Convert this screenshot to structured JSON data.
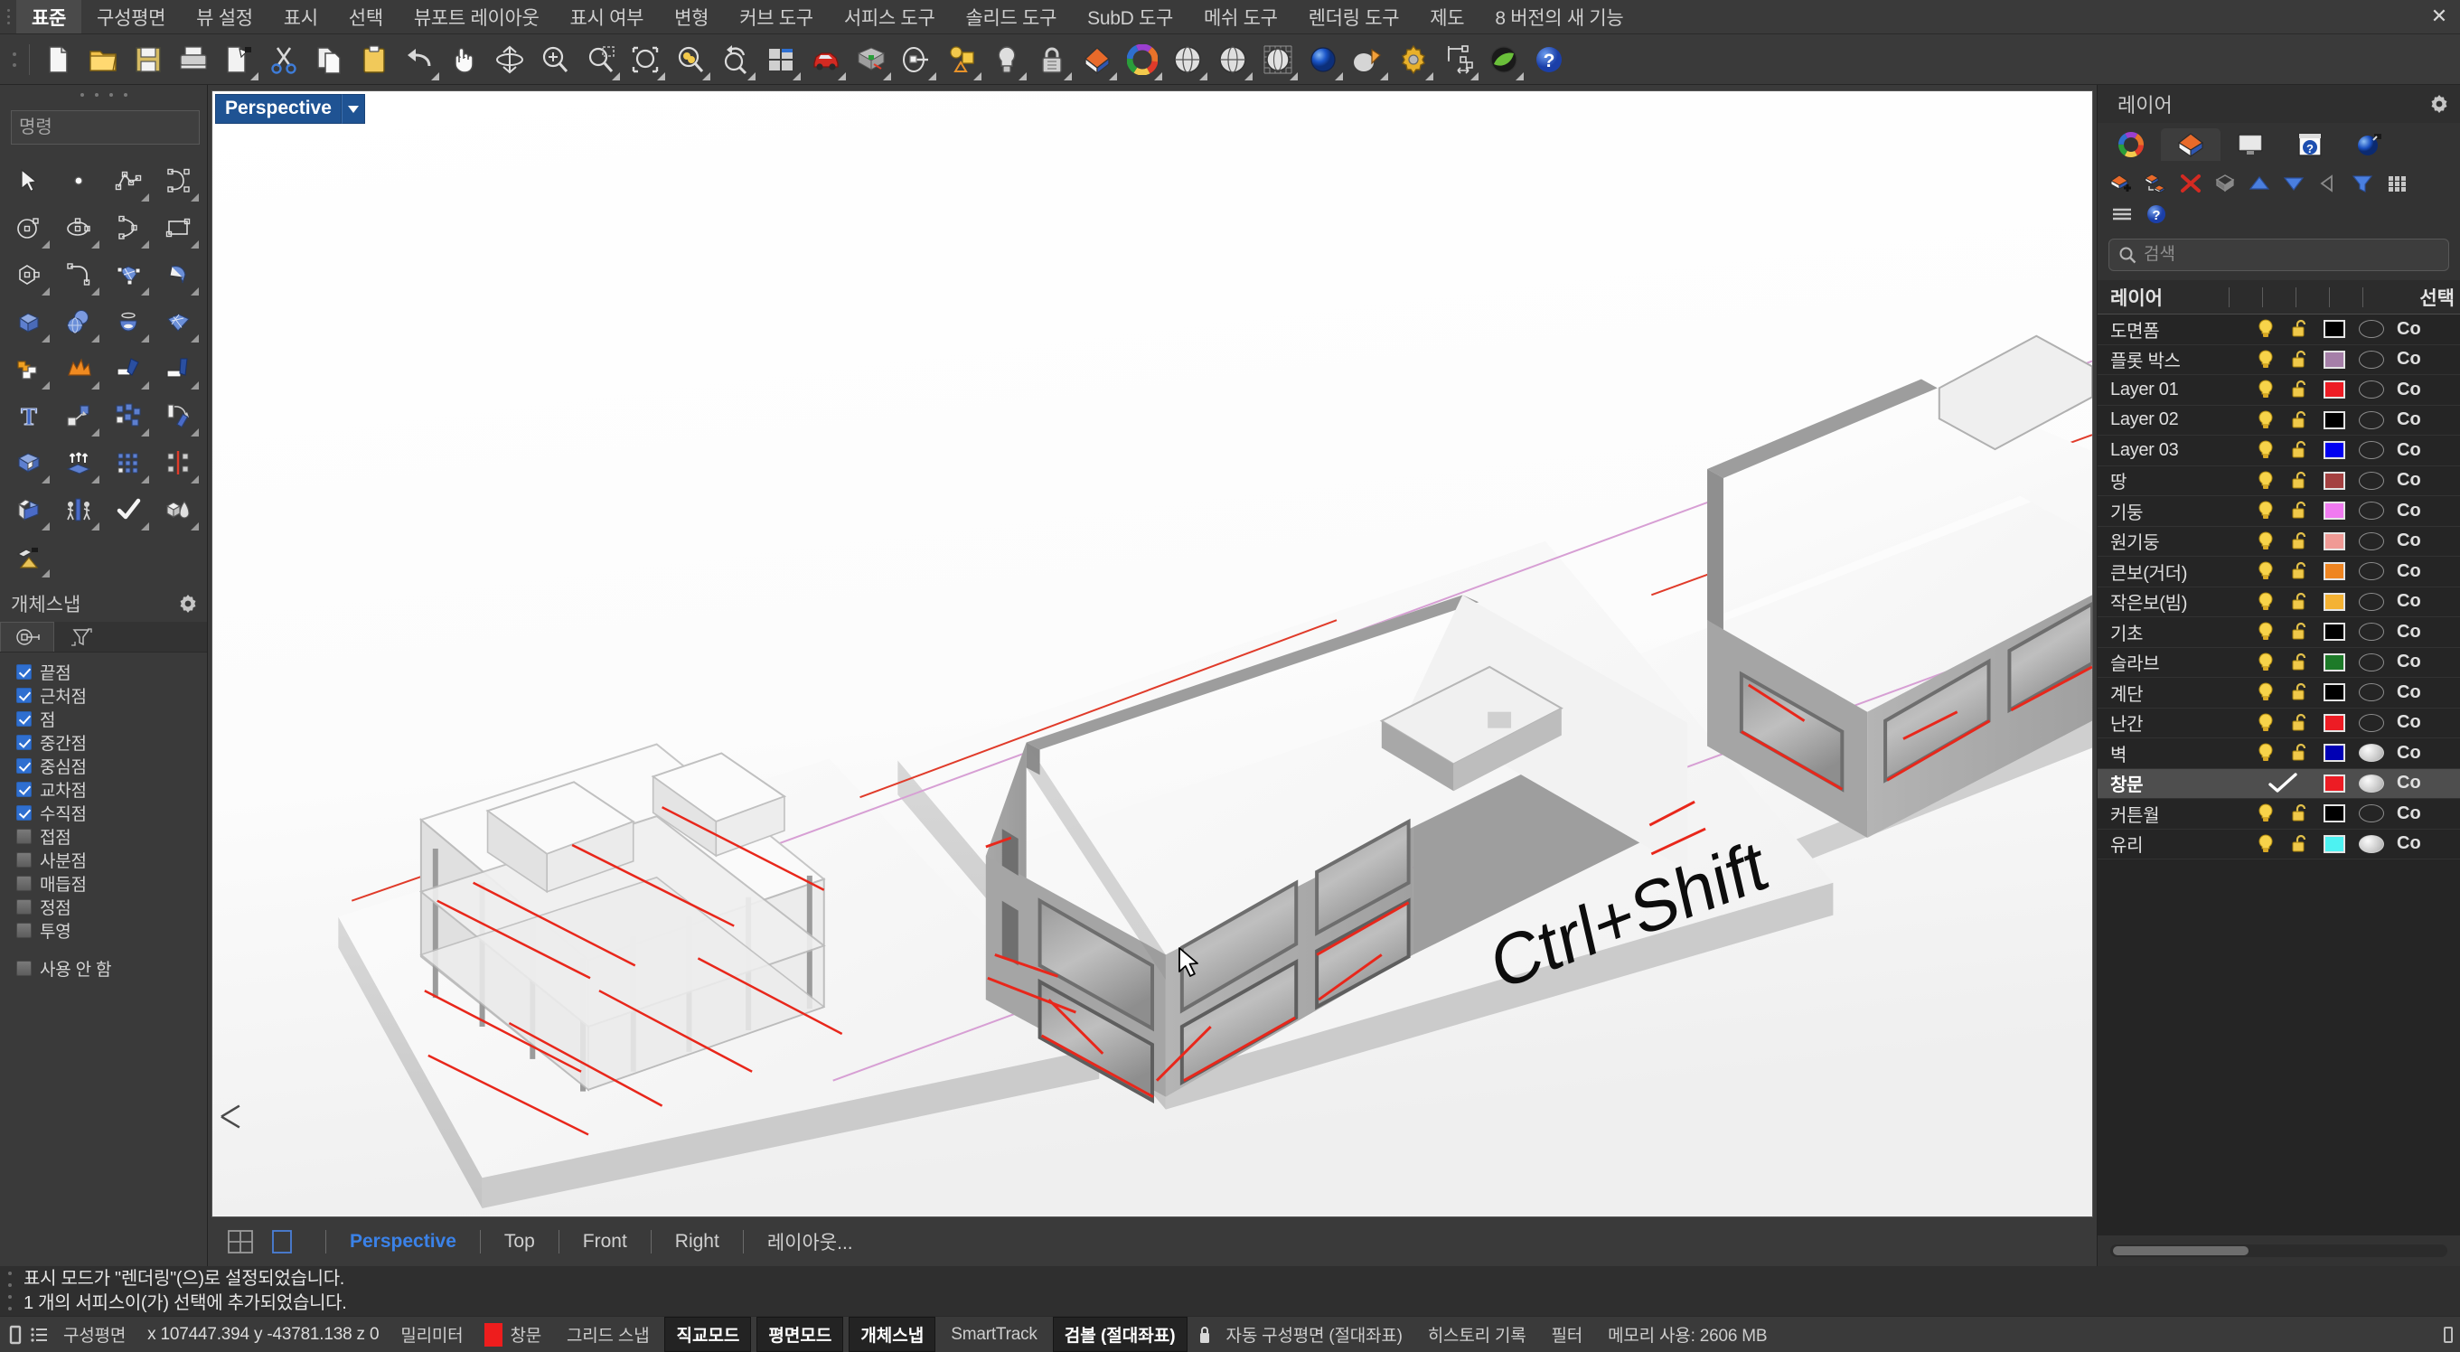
{
  "menu": {
    "items": [
      {
        "label": "표준",
        "active": true
      },
      {
        "label": "구성평면",
        "active": false
      },
      {
        "label": "뷰 설정",
        "active": false
      },
      {
        "label": "표시",
        "active": false
      },
      {
        "label": "선택",
        "active": false
      },
      {
        "label": "뷰포트 레이아웃",
        "active": false
      },
      {
        "label": "표시 여부",
        "active": false
      },
      {
        "label": "변형",
        "active": false
      },
      {
        "label": "커브 도구",
        "active": false
      },
      {
        "label": "서피스 도구",
        "active": false
      },
      {
        "label": "솔리드 도구",
        "active": false
      },
      {
        "label": "SubD 도구",
        "active": false
      },
      {
        "label": "메쉬 도구",
        "active": false
      },
      {
        "label": "렌더링 도구",
        "active": false
      },
      {
        "label": "제도",
        "active": false
      },
      {
        "label": "8 버전의 새 기능",
        "active": false
      }
    ],
    "close_label": "✕"
  },
  "toolbar": {
    "icons": [
      "new-file-icon",
      "open-folder-icon",
      "save-disk-icon",
      "print-icon",
      "save-as-icon",
      "cut-scissors-icon",
      "copy-icon",
      "paste-clipboard-icon",
      "undo-arrow-icon",
      "pan-hand-icon",
      "rotate-view-icon",
      "zoom-inout-icon",
      "zoom-window-icon",
      "zoom-selected-icon",
      "zoom-extents-icon",
      "zoom-dynamic-icon",
      "redo-view-icon",
      "viewport-layout-icon",
      "car-render-icon",
      "grid-deform-icon",
      "cplane-icon",
      "object-props-icon",
      "light-bulb-icon",
      "lock-padlock-icon",
      "layer-icon",
      "color-wheel-icon",
      "shaded-sphere-icon",
      "render-sphere-icon",
      "ghosted-sphere-icon",
      "render-blue-sphere-icon",
      "spotlight-icon",
      "gear-options-icon",
      "dimension-icon",
      "render-green-icon",
      "help-question-icon"
    ]
  },
  "command": {
    "placeholder": "명령",
    "value": ""
  },
  "tool_palette": {
    "icons": [
      "select-arrow-icon",
      "point-icon",
      "polyline-icon",
      "curve-icon",
      "circle-icon",
      "ellipse-icon",
      "arc-icon",
      "rectangle-icon",
      "polygon-icon",
      "fillet-curve-icon",
      "surface-patch-icon",
      "extrude-surface-icon",
      "box-icon",
      "sphere-union-icon",
      "revolve-icon",
      "surface-grid-icon",
      "boolean-union-icon",
      "explode-icon",
      "trim-icon",
      "split-icon",
      "text-icon",
      "move-icon",
      "copy-objects-icon",
      "rotate-icon",
      "extrude-solid-icon",
      "offset-icon",
      "array-icon",
      "mirror-icon",
      "fillet-edge-icon",
      "push-pull-icon",
      "check-mark-icon",
      "shape-boolean-icon",
      "paint-bucket-icon"
    ]
  },
  "object_snap": {
    "title": "개체스냅",
    "gear_icon": "gear-icon",
    "tabs": [
      {
        "name": "osnap-tab-icon",
        "active": true
      },
      {
        "name": "filter-tab-icon",
        "active": false
      }
    ],
    "items": [
      {
        "label": "끝점",
        "checked": true
      },
      {
        "label": "근처점",
        "checked": true
      },
      {
        "label": "점",
        "checked": true
      },
      {
        "label": "중간점",
        "checked": true
      },
      {
        "label": "중심점",
        "checked": true
      },
      {
        "label": "교차점",
        "checked": true
      },
      {
        "label": "수직점",
        "checked": true
      },
      {
        "label": "접점",
        "checked": false
      },
      {
        "label": "사분점",
        "checked": false
      },
      {
        "label": "매듭점",
        "checked": false
      },
      {
        "label": "정점",
        "checked": false
      },
      {
        "label": "투영",
        "checked": false
      }
    ],
    "disable": {
      "label": "사용 안 함",
      "checked": false
    }
  },
  "viewport": {
    "label": "Perspective",
    "dropdown_icon": "chevron-down-icon",
    "scene_text": "Ctrl+Shift",
    "cursor_icon": "mouse-pointer-icon",
    "tabs": [
      {
        "label": "Perspective",
        "active": true
      },
      {
        "label": "Top",
        "active": false
      },
      {
        "label": "Front",
        "active": false
      },
      {
        "label": "Right",
        "active": false
      },
      {
        "label": "레이아웃...",
        "active": false
      }
    ],
    "layout_icons": [
      "four-view-layout-icon",
      "single-view-layout-icon"
    ]
  },
  "layer_panel": {
    "title": "레이어",
    "gear_icon": "gear-icon",
    "tabs": [
      {
        "name": "color-wheel-tab-icon",
        "active": false
      },
      {
        "name": "layers-tab-icon",
        "active": true
      },
      {
        "name": "display-tab-icon",
        "active": false
      },
      {
        "name": "help-window-tab-icon",
        "active": false
      },
      {
        "name": "render-sphere-tab-icon",
        "active": false
      }
    ],
    "tools": [
      "new-layer-icon",
      "new-sublayer-icon",
      "delete-layer-icon",
      "select-objects-icon",
      "move-up-icon",
      "move-down-icon",
      "back-arrow-icon",
      "filter-funnel-icon",
      "grid-view-icon",
      "hamburger-menu-icon",
      "help-question-icon"
    ],
    "search": {
      "placeholder": "검색",
      "value": "",
      "icon": "search-icon"
    },
    "columns": {
      "name": "레이어",
      "select": "선택"
    },
    "rows": [
      {
        "name": "도면폼",
        "visible": true,
        "locked": false,
        "color": "#000000",
        "material": false,
        "print": "Co",
        "selected": false
      },
      {
        "name": "플롯 박스",
        "visible": true,
        "locked": false,
        "color": "#a57fa8",
        "material": false,
        "print": "Co",
        "selected": false
      },
      {
        "name": "Layer 01",
        "visible": true,
        "locked": false,
        "color": "#ed1c24",
        "material": false,
        "print": "Co",
        "selected": false
      },
      {
        "name": "Layer 02",
        "visible": true,
        "locked": false,
        "color": "#000000",
        "material": false,
        "print": "Co",
        "selected": false
      },
      {
        "name": "Layer 03",
        "visible": true,
        "locked": false,
        "color": "#0000f0",
        "material": false,
        "print": "Co",
        "selected": false
      },
      {
        "name": "땅",
        "visible": true,
        "locked": false,
        "color": "#a44141",
        "material": false,
        "print": "Co",
        "selected": false
      },
      {
        "name": "기둥",
        "visible": true,
        "locked": false,
        "color": "#f07af0",
        "material": false,
        "print": "Co",
        "selected": false
      },
      {
        "name": "원기둥",
        "visible": true,
        "locked": false,
        "color": "#f09a95",
        "material": false,
        "print": "Co",
        "selected": false
      },
      {
        "name": "큰보(거더)",
        "visible": true,
        "locked": false,
        "color": "#ef8521",
        "material": false,
        "print": "Co",
        "selected": false
      },
      {
        "name": "작은보(빔)",
        "visible": true,
        "locked": false,
        "color": "#f4b233",
        "material": false,
        "print": "Co",
        "selected": false
      },
      {
        "name": "기초",
        "visible": true,
        "locked": false,
        "color": "#000000",
        "material": false,
        "print": "Co",
        "selected": false
      },
      {
        "name": "슬라브",
        "visible": true,
        "locked": false,
        "color": "#1d7a28",
        "material": false,
        "print": "Co",
        "selected": false
      },
      {
        "name": "계단",
        "visible": true,
        "locked": false,
        "color": "#000000",
        "material": false,
        "print": "Co",
        "selected": false
      },
      {
        "name": "난간",
        "visible": true,
        "locked": false,
        "color": "#ed1c24",
        "material": false,
        "print": "Co",
        "selected": false
      },
      {
        "name": "벽",
        "visible": true,
        "locked": false,
        "color": "#0000b4",
        "material": true,
        "print": "Co",
        "selected": false
      },
      {
        "name": "창문",
        "visible": null,
        "locked": null,
        "color": "#ed1c24",
        "material": true,
        "print": "Co",
        "selected": true,
        "check_icon": "check-mark-icon"
      },
      {
        "name": "커튼월",
        "visible": true,
        "locked": false,
        "color": "#000000",
        "material": false,
        "print": "Co",
        "selected": false
      },
      {
        "name": "유리",
        "visible": true,
        "locked": false,
        "color": "#4df2f2",
        "material": true,
        "print": "Co",
        "selected": false
      }
    ]
  },
  "history": {
    "lines": [
      "표시 모드가 \"렌더링\"(으)로 설정되었습니다.",
      "1 개의 서피스이(가) 선택에 추가되었습니다."
    ]
  },
  "status_bar": {
    "left_icons": [
      "cplane-toggle-icon",
      "list-icon"
    ],
    "cplane_label": "구성평면",
    "coordinates": "x 107447.394  y -43781.138  z 0",
    "units": "밀리미터",
    "current_layer": "창문",
    "current_layer_color": "#ee1d1d",
    "grid_snap": "그리드 스냅",
    "buttons": [
      {
        "label": "직교모드",
        "active": true
      },
      {
        "label": "평면모드",
        "active": true
      },
      {
        "label": "개체스냅",
        "active": true
      }
    ],
    "smart_track": "SmartTrack",
    "gumball": {
      "label": "검볼 (절대좌표)",
      "active": true
    },
    "lock_icon": "padlock-icon",
    "auto_cplane": "자동 구성평면 (절대좌표)",
    "history_record": "히스토리 기록",
    "filter": "필터",
    "memory": "메모리 사용: 2606 MB",
    "resize_icon": "resize-grip-icon"
  }
}
